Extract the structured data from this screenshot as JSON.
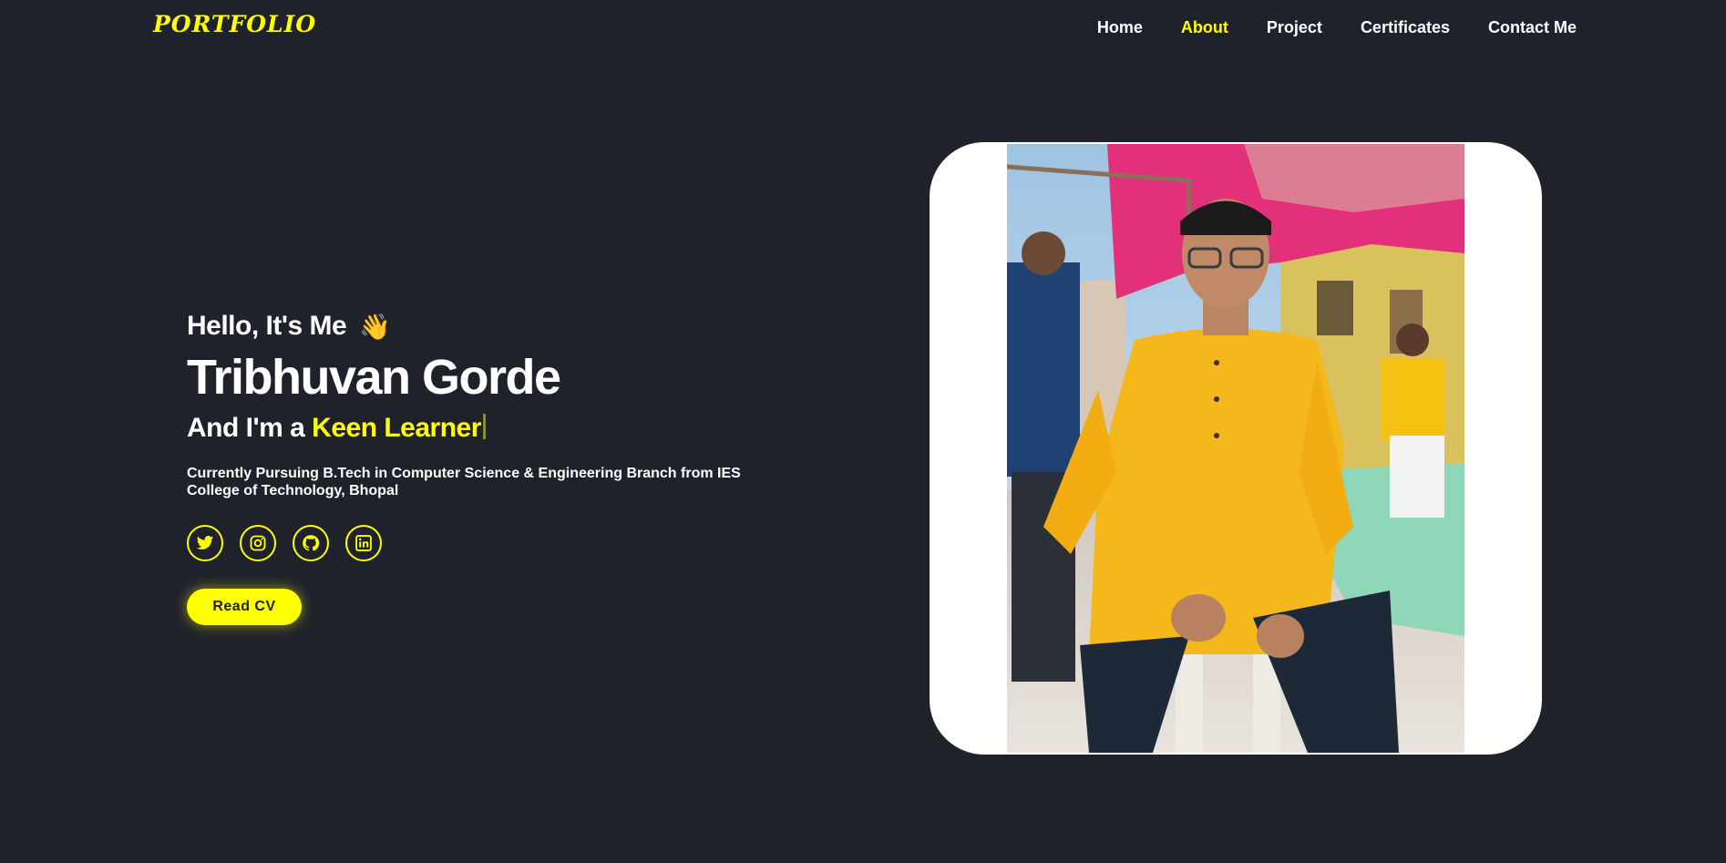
{
  "brand": {
    "logo_text": "PORTFOLIO",
    "accent": "#ffff00",
    "background": "#1f222b"
  },
  "nav": {
    "items": [
      {
        "label": "Home",
        "active": false
      },
      {
        "label": "About",
        "active": true
      },
      {
        "label": "Project",
        "active": false
      },
      {
        "label": "Certificates",
        "active": false
      },
      {
        "label": "Contact Me",
        "active": false
      }
    ]
  },
  "hero": {
    "greeting": "Hello, It's Me",
    "wave_emoji": "👋",
    "name": "Tribhuvan Gorde",
    "role_prefix": "And I'm a ",
    "role_highlight": "Keen Learner",
    "description": "Currently Pursuing B.Tech in Computer Science & Engineering Branch from IES College of Technology, Bhopal",
    "cta_label": "Read CV"
  },
  "socials": [
    {
      "icon": "twitter-icon"
    },
    {
      "icon": "instagram-icon"
    },
    {
      "icon": "github-icon"
    },
    {
      "icon": "linkedin-icon"
    }
  ],
  "profile_photo": {
    "subject": "person-in-yellow-kurta-seated-on-chair"
  }
}
